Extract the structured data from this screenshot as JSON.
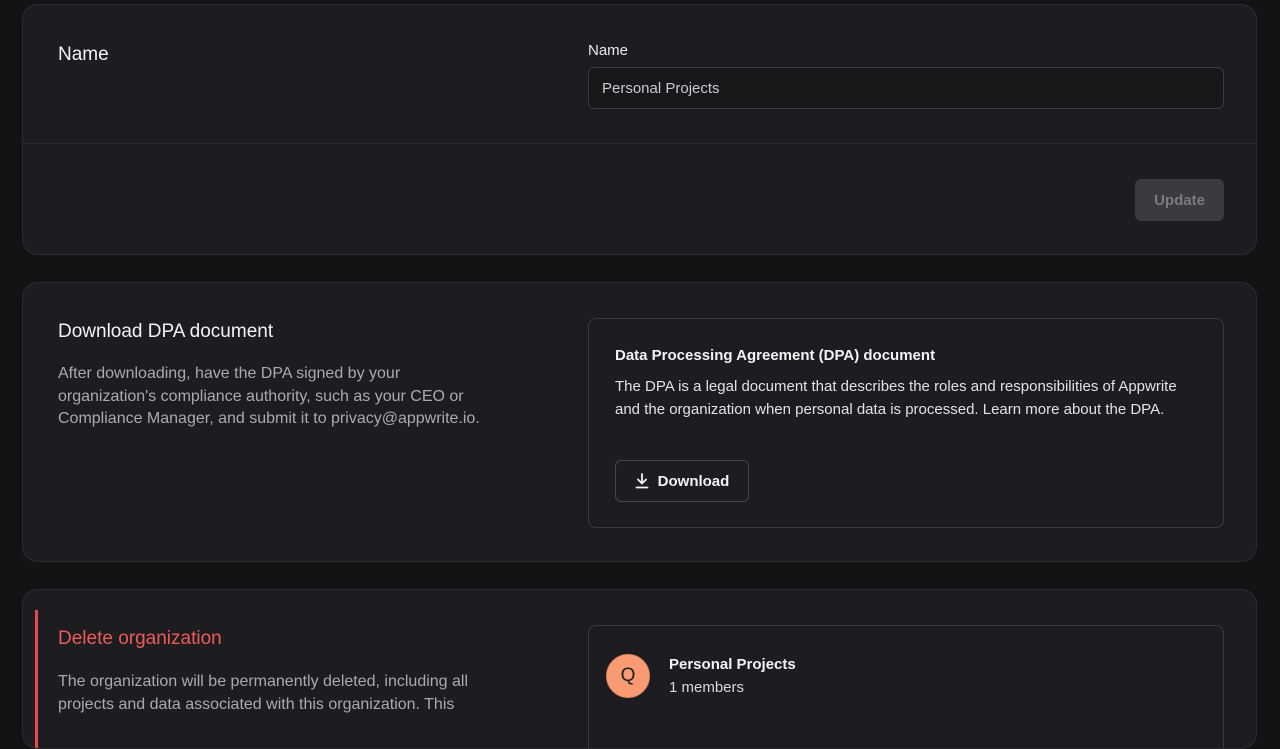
{
  "name_section": {
    "title": "Name",
    "field_label": "Name",
    "field_value": "Personal Projects",
    "update_label": "Update"
  },
  "dpa_section": {
    "title": "Download DPA document",
    "description": "After downloading, have the DPA signed by your organization's compliance authority, such as your CEO or Compliance Manager, and submit it to privacy@appwrite.io.",
    "box_title": "Data Processing Agreement (DPA) document",
    "box_text": "The DPA is a legal document that describes the roles and responsibilities of Appwrite and the organization when personal data is processed. Learn more about the DPA.",
    "download_label": "Download",
    "download_icon": "download-icon"
  },
  "delete_section": {
    "title": "Delete organization",
    "description": "The organization will be permanently deleted, including all projects and data associated with this organization. This",
    "org_initial": "Q",
    "org_name": "Personal Projects",
    "member_count": "1 members"
  },
  "colors": {
    "danger": "#ec5b58",
    "avatar": "#f89b73",
    "background": "#131316",
    "card": "#1d1d21"
  }
}
